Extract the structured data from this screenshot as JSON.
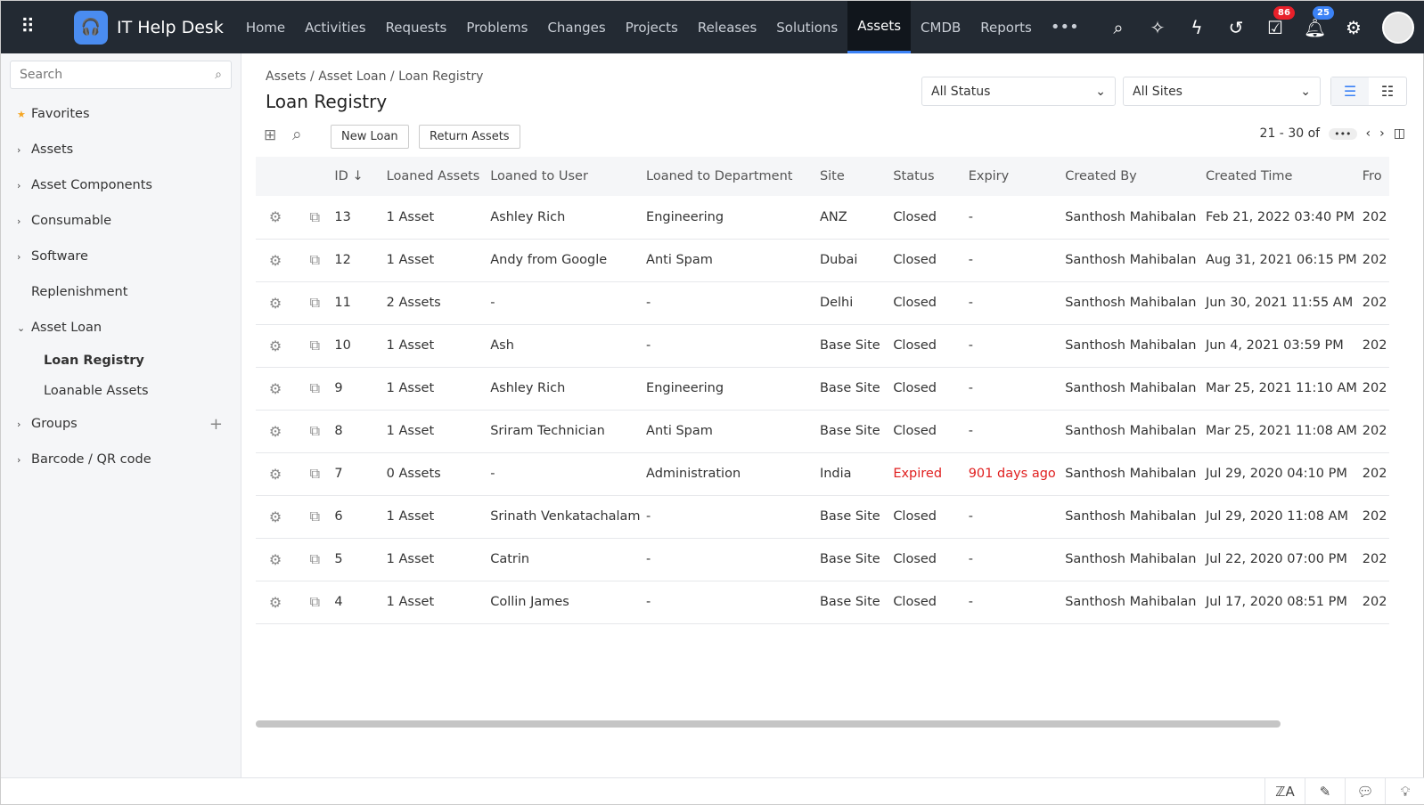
{
  "app": {
    "title": "IT Help Desk"
  },
  "nav": [
    "Home",
    "Activities",
    "Requests",
    "Problems",
    "Changes",
    "Projects",
    "Releases",
    "Solutions",
    "Assets",
    "CMDB",
    "Reports"
  ],
  "badges": {
    "approvals": "86",
    "notifications": "25"
  },
  "sidebar": {
    "search_placeholder": "Search",
    "items": [
      {
        "label": "Favorites"
      },
      {
        "label": "Assets"
      },
      {
        "label": "Asset Components"
      },
      {
        "label": "Consumable"
      },
      {
        "label": "Software"
      },
      {
        "label": "Replenishment"
      },
      {
        "label": "Asset Loan"
      },
      {
        "label": "Loan Registry"
      },
      {
        "label": "Loanable Assets"
      },
      {
        "label": "Groups"
      },
      {
        "label": "Barcode / QR code"
      }
    ]
  },
  "breadcrumb": [
    "Assets",
    "Asset Loan",
    "Loan Registry"
  ],
  "page_title": "Loan Registry",
  "filters": {
    "status": "All Status",
    "site": "All Sites"
  },
  "toolbar": {
    "new_loan": "New Loan",
    "return_assets": "Return Assets"
  },
  "pager": {
    "range": "21 - 30 of",
    "more": "•••"
  },
  "table": {
    "headers": [
      "ID ↓",
      "Loaned Assets",
      "Loaned to User",
      "Loaned to Department",
      "Site",
      "Status",
      "Expiry",
      "Created By",
      "Created Time",
      "Fro"
    ],
    "rows": [
      [
        "13",
        "1 Asset",
        "Ashley Rich",
        "Engineering",
        "ANZ",
        "Closed",
        "-",
        "Santhosh Mahibalan",
        "Feb 21, 2022 03:40 PM",
        "202"
      ],
      [
        "12",
        "1 Asset",
        "Andy from Google",
        "Anti Spam",
        "Dubai",
        "Closed",
        "-",
        "Santhosh Mahibalan",
        "Aug 31, 2021 06:15 PM",
        "202"
      ],
      [
        "11",
        "2 Assets",
        "-",
        "-",
        "Delhi",
        "Closed",
        "-",
        "Santhosh Mahibalan",
        "Jun 30, 2021 11:55 AM",
        "202"
      ],
      [
        "10",
        "1 Asset",
        "Ash",
        "-",
        "Base Site",
        "Closed",
        "-",
        "Santhosh Mahibalan",
        "Jun 4, 2021 03:59 PM",
        "202"
      ],
      [
        "9",
        "1 Asset",
        "Ashley Rich",
        "Engineering",
        "Base Site",
        "Closed",
        "-",
        "Santhosh Mahibalan",
        "Mar 25, 2021 11:10 AM",
        "202"
      ],
      [
        "8",
        "1 Asset",
        "Sriram Technician",
        "Anti Spam",
        "Base Site",
        "Closed",
        "-",
        "Santhosh Mahibalan",
        "Mar 25, 2021 11:08 AM",
        "202"
      ],
      [
        "7",
        "0 Assets",
        "-",
        "Administration",
        "India",
        "Expired",
        "901 days ago",
        "Santhosh Mahibalan",
        "Jul 29, 2020 04:10 PM",
        "202"
      ],
      [
        "6",
        "1 Asset",
        "Srinath Venkatachalam",
        "-",
        "Base Site",
        "Closed",
        "-",
        "Santhosh Mahibalan",
        "Jul 29, 2020 11:08 AM",
        "202"
      ],
      [
        "5",
        "1 Asset",
        "Catrin",
        "-",
        "Base Site",
        "Closed",
        "-",
        "Santhosh Mahibalan",
        "Jul 22, 2020 07:00 PM",
        "202"
      ],
      [
        "4",
        "1 Asset",
        "Collin James",
        "-",
        "Base Site",
        "Closed",
        "-",
        "Santhosh Mahibalan",
        "Jul 17, 2020 08:51 PM",
        "202"
      ]
    ]
  }
}
